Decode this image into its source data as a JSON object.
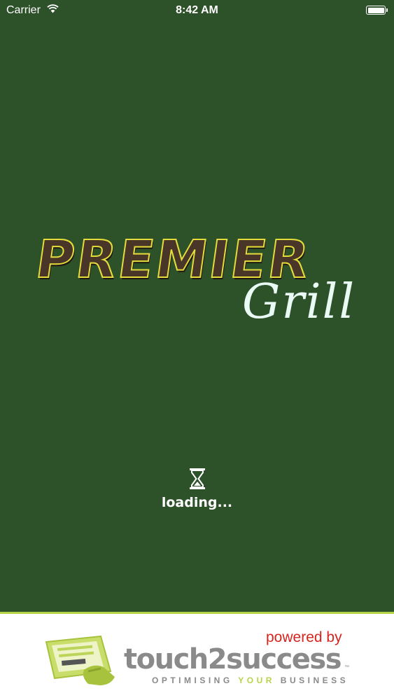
{
  "status_bar": {
    "carrier": "Carrier",
    "time": "8:42 AM"
  },
  "logo": {
    "line1": "PREMIER",
    "line2": "Grill"
  },
  "loading": {
    "label": "loading..."
  },
  "footer": {
    "powered_by": "powered by",
    "brand": "touch2success",
    "trademark": "™",
    "tagline_part1": "OPTIMISING ",
    "tagline_accent": "YOUR",
    "tagline_part2": " BUSINESS"
  },
  "colors": {
    "background": "#2d5129",
    "footer_accent": "#b7d34a",
    "powered_by": "#d6251f"
  }
}
